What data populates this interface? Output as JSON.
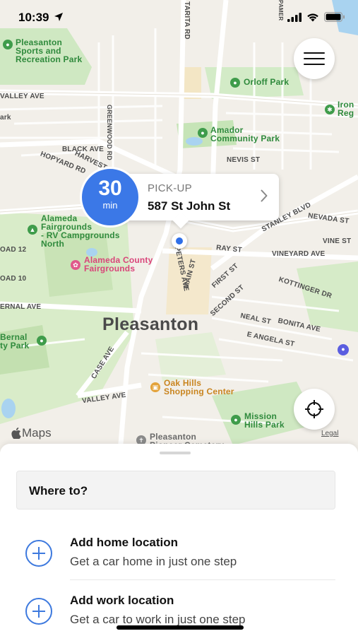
{
  "status_bar": {
    "time": "10:39"
  },
  "map": {
    "city": "Pleasanton",
    "streets": [
      "VALLEY AVE",
      "BLACK AVE",
      "HOPYARD RD",
      "HARVEST",
      "GREENWOOD RD",
      "NEVIS ST",
      "STANLEY BLVD",
      "NEVADA ST",
      "VINE ST",
      "RAY ST",
      "VINEYARD AVE",
      "PETERS AVE",
      "MAIN ST",
      "FIRST ST",
      "SECOND ST",
      "KOTTINGER DR",
      "NEAL ST",
      "BONITA AVE",
      "E ANGELA ST",
      "CASE AVE",
      "VALLEY AVE",
      "ERNAL AVE",
      "OAD 12",
      "OAD 10",
      "ark",
      "TARITA RD",
      "PAMER"
    ],
    "pois": {
      "sports_park": "Pleasanton\nSports and\nRecreation Park",
      "orloff_park": "Orloff Park",
      "iron": "Iron\nReg",
      "amador_park": "Amador\nCommunity Park",
      "fairgrounds_rv": "Alameda\nFairgrounds\n- RV Campgrounds\nNorth",
      "county_fairgrounds": "Alameda County\nFairgrounds",
      "bernal_park": "Bernal\nty Park",
      "oak_hills": "Oak Hills\nShopping Center",
      "mission_hills": "Mission\nHills Park",
      "cemetery": "Pleasanton\nPioneer Cemetery"
    },
    "maps_brand": "Maps",
    "legal": "Legal"
  },
  "pickup": {
    "eta_value": "30",
    "eta_unit": "min",
    "label": "PICK-UP",
    "address": "587 St John St"
  },
  "sheet": {
    "search_placeholder": "Where to?",
    "saved": [
      {
        "title": "Add home location",
        "subtitle": "Get a car home in just one step"
      },
      {
        "title": "Add work location",
        "subtitle": "Get a car to work in just one step"
      }
    ]
  },
  "colors": {
    "accent": "#3d79de",
    "eta_bg": "#3b78e7",
    "park_green": "#2f8a3c",
    "map_bg": "#f2efe9"
  },
  "icons": [
    "location-arrow-icon",
    "signal-icon",
    "wifi-icon",
    "battery-icon",
    "hamburger-menu-icon",
    "chevron-right-icon",
    "crosshair-icon",
    "apple-logo-icon",
    "plus-circle-icon"
  ]
}
